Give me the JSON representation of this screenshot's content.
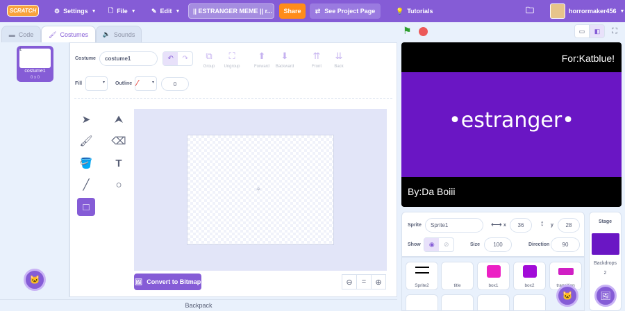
{
  "menubar": {
    "logo": "SCRATCH",
    "settings": "Settings",
    "file": "File",
    "edit": "Edit",
    "project_title": "|| ESTRANGER MEME || r...",
    "share": "Share",
    "see_project": "See Project Page",
    "tutorials": "Tutorials",
    "username": "horrormaker456"
  },
  "tabs": {
    "code": "Code",
    "costumes": "Costumes",
    "sounds": "Sounds"
  },
  "costume_list": [
    {
      "index": "1",
      "name": "costume1",
      "size": "0 x 0"
    }
  ],
  "editor": {
    "costume_label": "Costume",
    "costume_name": "costume1",
    "group": "Group",
    "ungroup": "Ungroup",
    "forward": "Forward",
    "backward": "Backward",
    "front": "Front",
    "back": "Back",
    "fill_label": "Fill",
    "outline_label": "Outline",
    "outline_width": "0",
    "convert": "Convert to Bitmap",
    "zoom_reset": "="
  },
  "stage": {
    "top_text": "For:Katblue!",
    "center_text": "•estranger•",
    "bottom_text": "By:Da Boiii"
  },
  "sprite_info": {
    "sprite_label": "Sprite",
    "sprite_name": "Sprite1",
    "x_label": "x",
    "x_value": "36",
    "y_label": "y",
    "y_value": "28",
    "show_label": "Show",
    "size_label": "Size",
    "size_value": "100",
    "direction_label": "Direction",
    "direction_value": "90"
  },
  "sprites": [
    {
      "name": "Sprite2"
    },
    {
      "name": "title"
    },
    {
      "name": "box1"
    },
    {
      "name": "box2"
    },
    {
      "name": "transition"
    }
  ],
  "stage_panel": {
    "title": "Stage",
    "backdrops_label": "Backdrops",
    "backdrops_count": "2"
  },
  "backpack": "Backpack",
  "colors": {
    "accent": "#855cd6",
    "share": "#ff8c1a",
    "stage_band": "#6a16c4"
  }
}
